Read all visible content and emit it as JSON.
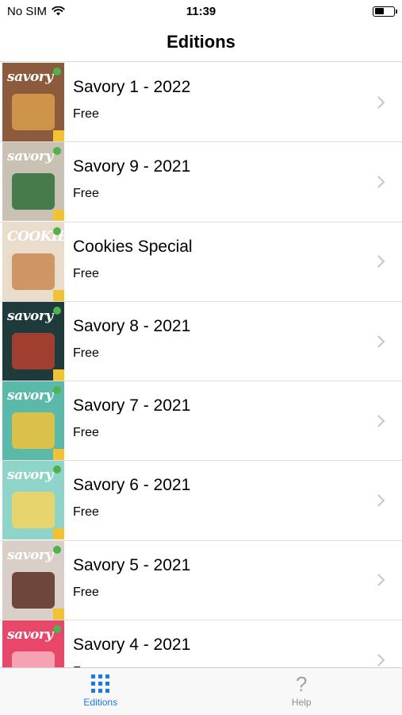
{
  "status": {
    "carrier": "No SIM",
    "time": "11:39",
    "battery_level": 0.5
  },
  "nav": {
    "title": "Editions"
  },
  "editions": [
    {
      "title": "Savory 1 - 2022",
      "price": "Free",
      "cover_color": "#8c5a3c",
      "art_color": "#d9a04a",
      "masthead": "savory"
    },
    {
      "title": "Savory 9 - 2021",
      "price": "Free",
      "cover_color": "#c9c2b4",
      "art_color": "#2f6e3a",
      "masthead": "savory"
    },
    {
      "title": "Cookies Special",
      "price": "Free",
      "cover_color": "#eadccb",
      "art_color": "#c98a52",
      "masthead": "COOKIES"
    },
    {
      "title": "Savory 8 - 2021",
      "price": "Free",
      "cover_color": "#1f3a3a",
      "art_color": "#b7402f",
      "masthead": "savory"
    },
    {
      "title": "Savory 7 - 2021",
      "price": "Free",
      "cover_color": "#5ab9a8",
      "art_color": "#f2c23a",
      "masthead": "savory"
    },
    {
      "title": "Savory 6 - 2021",
      "price": "Free",
      "cover_color": "#8fd4c9",
      "art_color": "#f4d55c",
      "masthead": "savory"
    },
    {
      "title": "Savory 5 - 2021",
      "price": "Free",
      "cover_color": "#d9cfc8",
      "art_color": "#5a2e22",
      "masthead": "savory"
    },
    {
      "title": "Savory 4 - 2021",
      "price": "Free",
      "cover_color": "#e8476a",
      "art_color": "#f7b3c0",
      "masthead": "savory"
    }
  ],
  "tabs": [
    {
      "label": "Editions",
      "icon": "grid-icon",
      "active": true
    },
    {
      "label": "Help",
      "icon": "question-mark-icon",
      "active": false
    }
  ],
  "colors": {
    "accent": "#1a7ae6",
    "inactive": "#8e8e93",
    "chevron": "#c4c4c9"
  }
}
